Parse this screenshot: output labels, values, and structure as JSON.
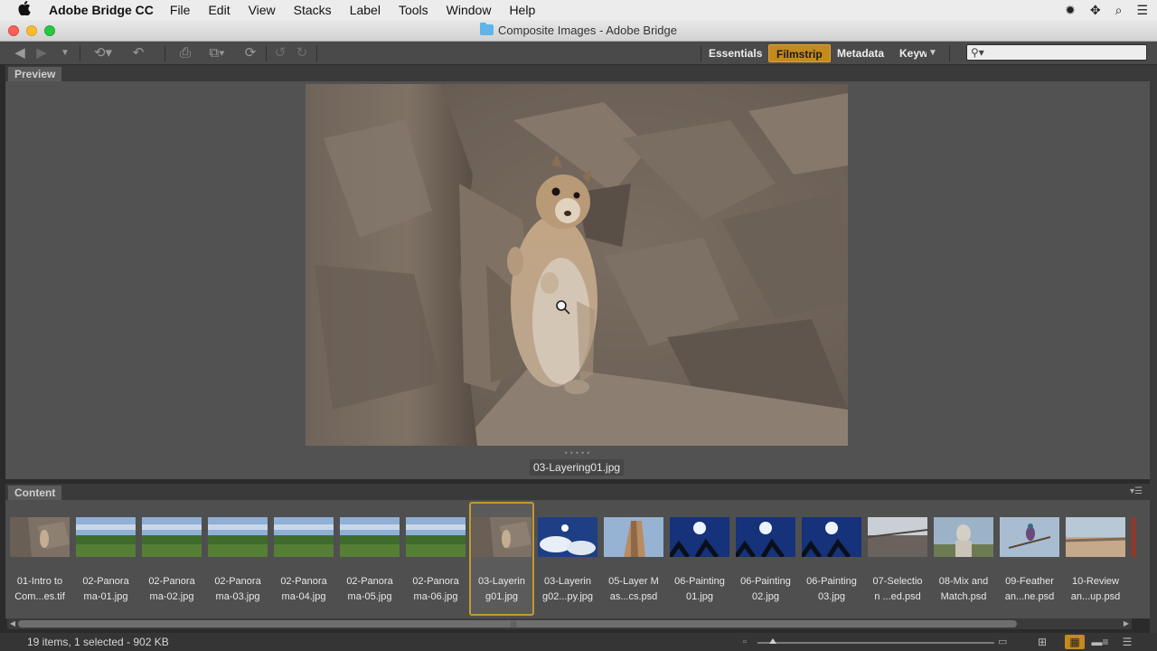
{
  "menubar": {
    "apple": "",
    "app_name": "Adobe Bridge CC",
    "items": [
      "File",
      "Edit",
      "View",
      "Stacks",
      "Label",
      "Tools",
      "Window",
      "Help"
    ]
  },
  "window": {
    "title": "Composite Images - Adobe Bridge"
  },
  "toolbar": {
    "workspaces": [
      {
        "label": "Essentials",
        "active": false
      },
      {
        "label": "Filmstrip",
        "active": true
      },
      {
        "label": "Metadata",
        "active": false
      },
      {
        "label": "Keyw",
        "active": false
      }
    ],
    "search": {
      "placeholder": "",
      "value": ""
    }
  },
  "preview": {
    "tab": "Preview",
    "filename": "03-Layering01.jpg"
  },
  "content": {
    "tab": "Content",
    "items": [
      {
        "line1": "01-Intro to",
        "line2": "Com...es.tif",
        "thumb": "rock"
      },
      {
        "line1": "02-Panora",
        "line2": "ma-01.jpg",
        "thumb": "pano"
      },
      {
        "line1": "02-Panora",
        "line2": "ma-02.jpg",
        "thumb": "pano"
      },
      {
        "line1": "02-Panora",
        "line2": "ma-03.jpg",
        "thumb": "pano"
      },
      {
        "line1": "02-Panora",
        "line2": "ma-04.jpg",
        "thumb": "pano"
      },
      {
        "line1": "02-Panora",
        "line2": "ma-05.jpg",
        "thumb": "pano"
      },
      {
        "line1": "02-Panora",
        "line2": "ma-06.jpg",
        "thumb": "pano"
      },
      {
        "line1": "03-Layerin",
        "line2": "g01.jpg",
        "thumb": "rock",
        "selected": true
      },
      {
        "line1": "03-Layerin",
        "line2": "g02...py.jpg",
        "thumb": "clouds"
      },
      {
        "line1": "05-Layer M",
        "line2": "as...cs.psd",
        "thumb": "building"
      },
      {
        "line1": "06-Painting",
        "line2": "01.jpg",
        "thumb": "sunpalm"
      },
      {
        "line1": "06-Painting",
        "line2": "02.jpg",
        "thumb": "sunpalm"
      },
      {
        "line1": "06-Painting",
        "line2": "03.jpg",
        "thumb": "sunpalm"
      },
      {
        "line1": "07-Selectio",
        "line2": "n ...ed.psd",
        "thumb": "wall"
      },
      {
        "line1": "08-Mix and",
        "line2": "Match.psd",
        "thumb": "statue"
      },
      {
        "line1": "09-Feather",
        "line2": "an...ne.psd",
        "thumb": "bird"
      },
      {
        "line1": "10-Review",
        "line2": "an...up.psd",
        "thumb": "beach"
      }
    ]
  },
  "status": {
    "text": "19 items, 1 selected - 902 KB"
  },
  "colors": {
    "accent": "#c38a1e",
    "selection": "#c49a2e"
  }
}
